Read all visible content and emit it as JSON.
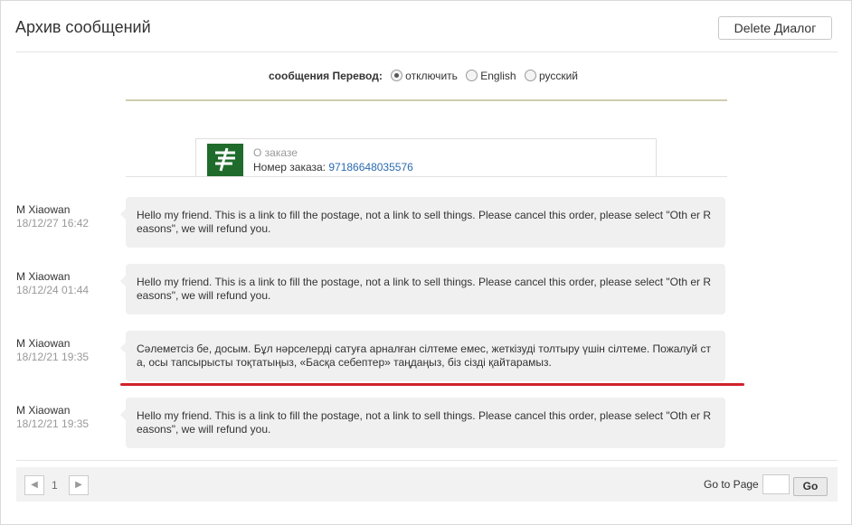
{
  "header": {
    "title": "Архив сообщений",
    "delete_label": "Delete Диалог"
  },
  "translate": {
    "label": "сообщения Перевод:",
    "options": [
      {
        "label": "отключить",
        "selected": true
      },
      {
        "label": "English",
        "selected": false
      },
      {
        "label": "русский",
        "selected": false
      }
    ]
  },
  "order": {
    "caption": "О заказе",
    "number_label": "Номер заказа:",
    "number": "97186648035576",
    "logo_color": "#1e6b2b"
  },
  "messages": [
    {
      "name": "M Xiaowan",
      "time": "18/12/27 16:42",
      "text": "Hello my friend. This is a link to fill the postage, not a link to sell things. Please cancel this order, please select \"Oth er Reasons\", we will refund you."
    },
    {
      "name": "M Xiaowan",
      "time": "18/12/24 01:44",
      "text": "Hello my friend. This is a link to fill the postage, not a link to sell things. Please cancel this order, please select \"Oth er Reasons\", we will refund you."
    },
    {
      "name": "M Xiaowan",
      "time": "18/12/21 19:35",
      "text": "Сәлеметсіз бе, досым. Бұл нәрселерді сатуға арналған сілтеме емес, жеткізуді толтыру үшін сілтеме. Пожалуй ста, осы тапсырысты тоқтатыңыз, «Басқа себептер» таңдаңыз, біз сізді қайтарамыз."
    },
    {
      "name": "M Xiaowan",
      "time": "18/12/21 19:35",
      "text": "Hello my friend. This is a link to fill the postage, not a link to sell things. Please cancel this order, please select \"Oth er Reasons\", we will refund you."
    }
  ],
  "pagination": {
    "current_page": "1",
    "prev_icon": "chevron-left-icon",
    "next_icon": "chevron-right-icon",
    "goto_label": "Go to Page",
    "go_label": "Go"
  },
  "colors": {
    "highlight": "#d0222a",
    "link": "#2a6ab0"
  }
}
